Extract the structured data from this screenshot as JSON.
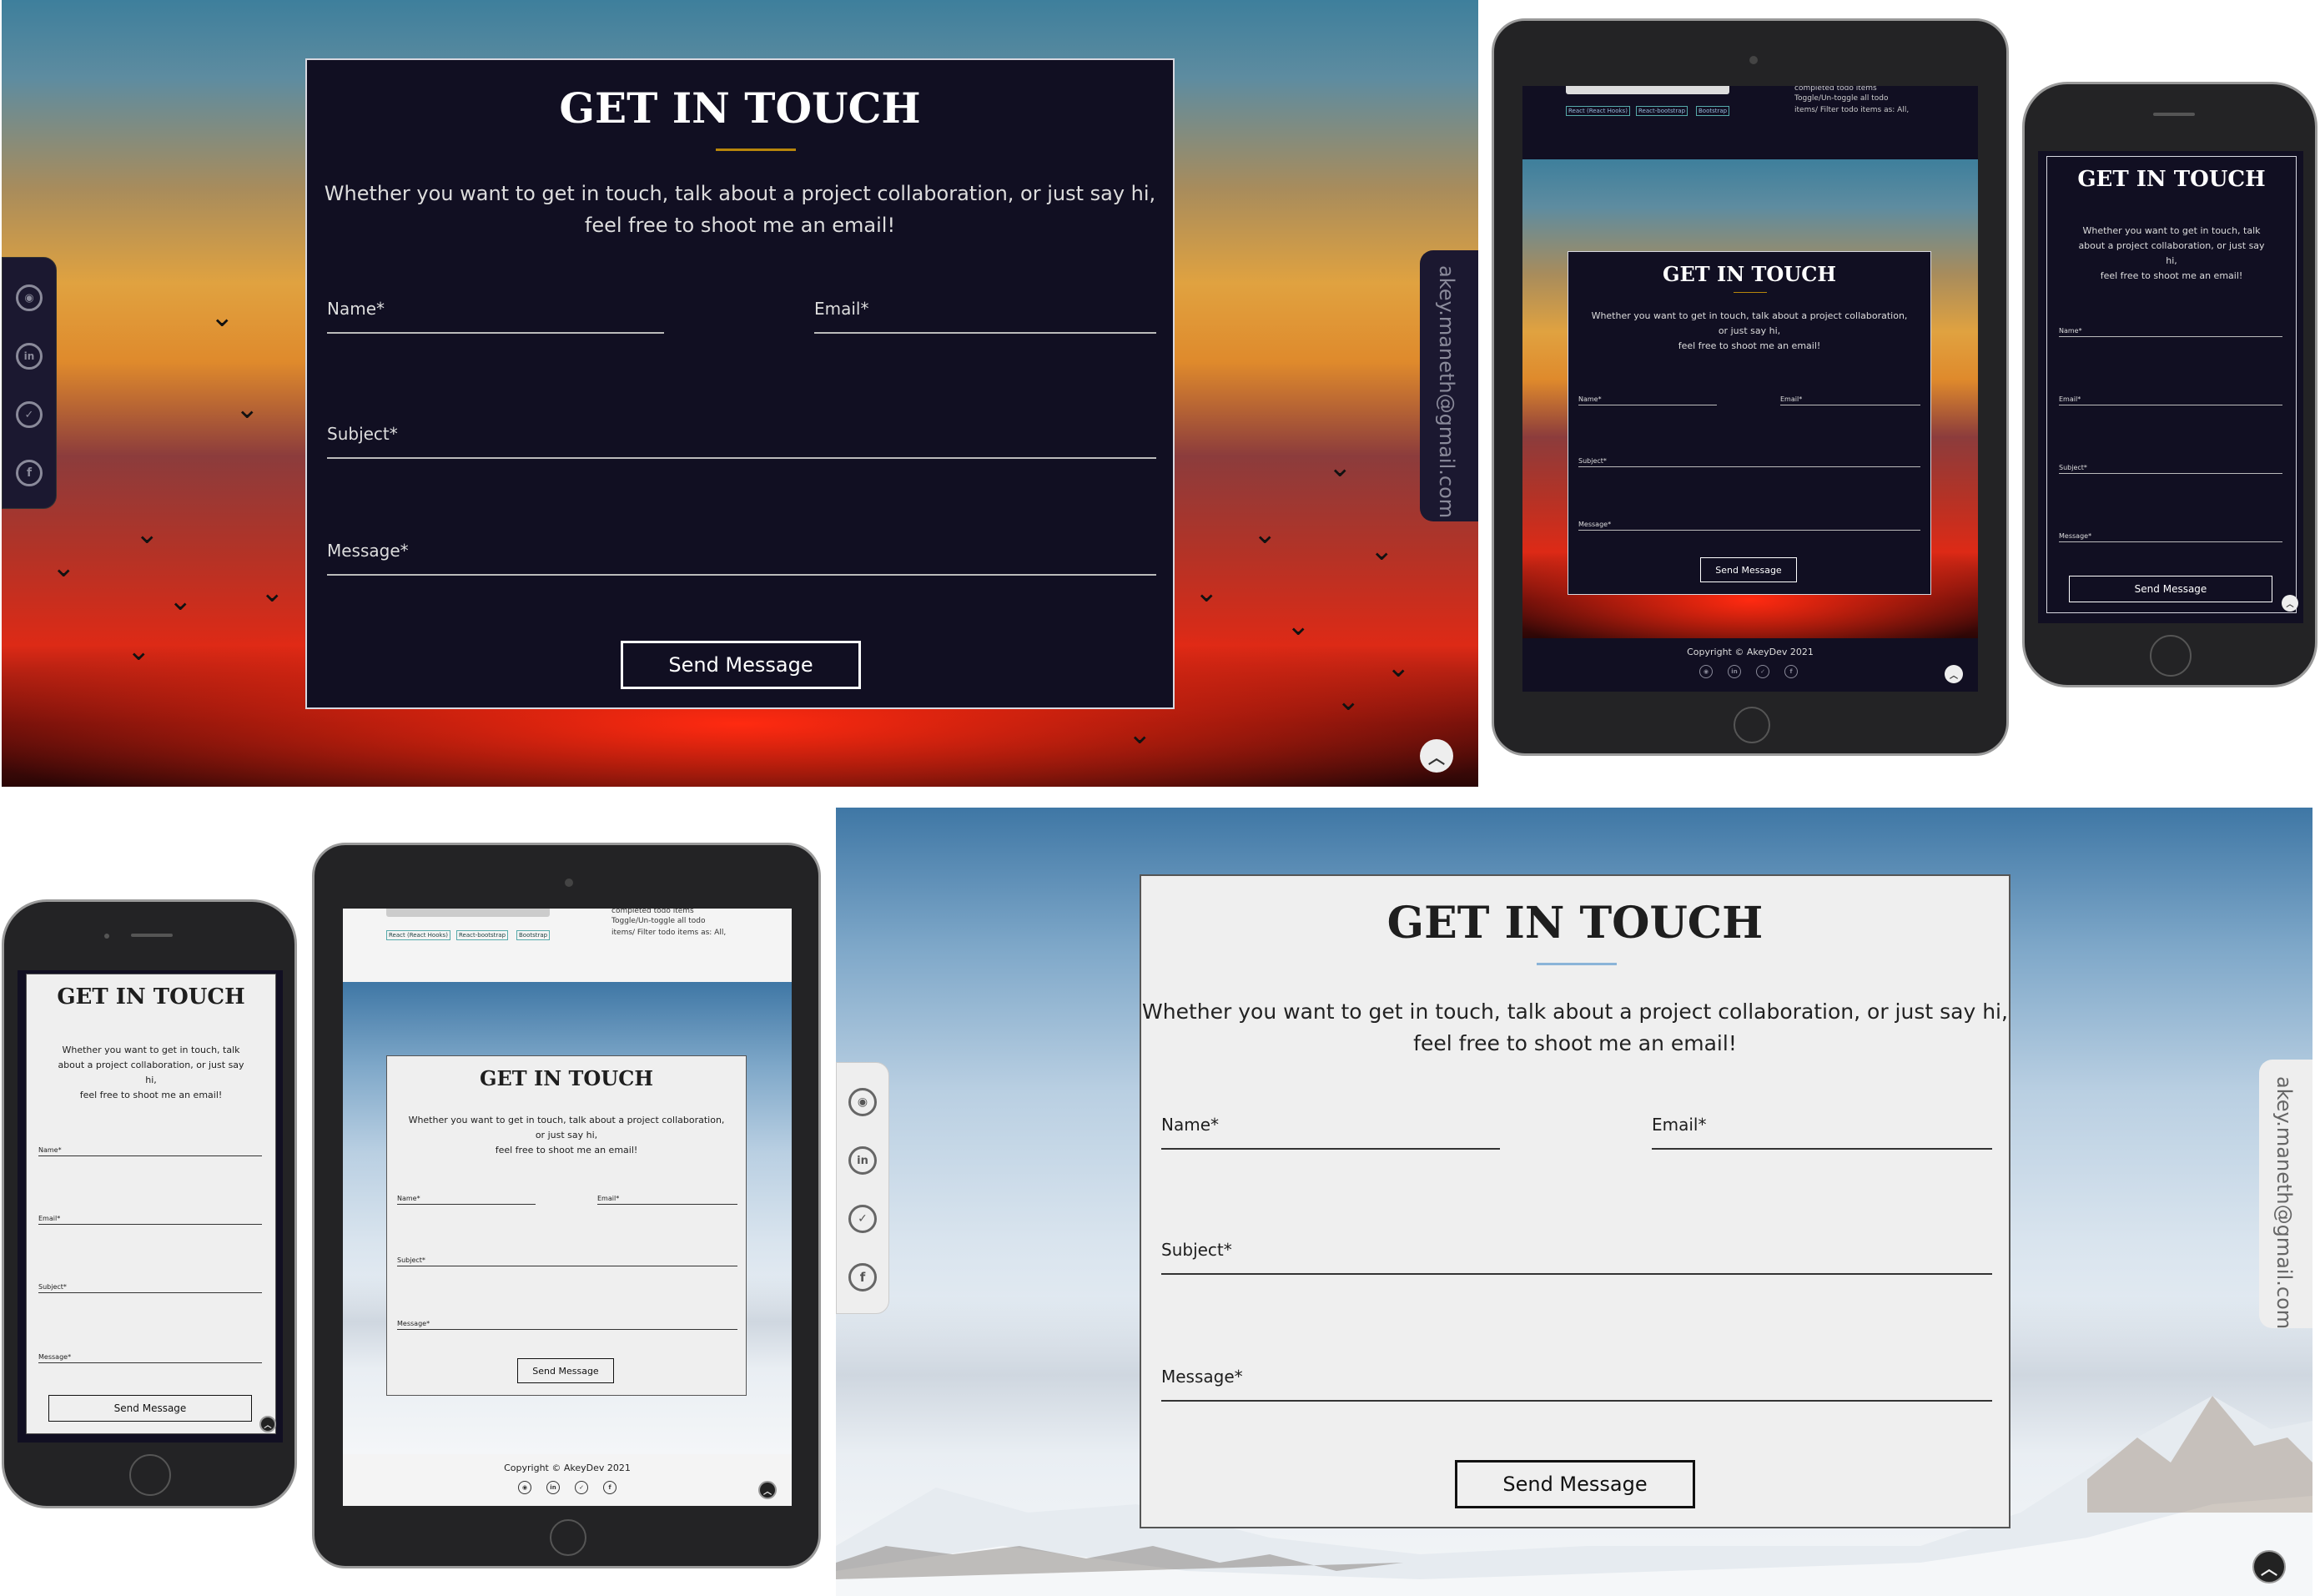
{
  "form": {
    "title": "GET IN TOUCH",
    "intro_line1": "Whether you want to get in touch, talk about a project collaboration, or just say hi,",
    "intro_line2": "feel free to shoot me an email!",
    "intro_small_1": "Whether you want to get in touch, talk about a project collaboration,",
    "intro_small_2": "or just say hi,",
    "phone_line1": "Whether you want to get in touch, talk",
    "phone_line2": "about a project collaboration, or just say",
    "phone_line3": "hi,",
    "name_label": "Name*",
    "email_label": "Email*",
    "subject_label": "Subject*",
    "message_label": "Message*",
    "send_label": "Send Message"
  },
  "email_vertical": "akey.maneth@gmail.com",
  "footer": {
    "copyright": "Copyright © AkeyDev 2021"
  },
  "project_snippet": {
    "desc_line0": "completed todo items",
    "desc_line1": "Toggle/Un-toggle all todo",
    "desc_line2": "items/ Filter todo items as: All,",
    "tag1": "React (React Hooks)",
    "tag2": "React-bootstrap",
    "tag3": "Bootstrap"
  },
  "social_icons": [
    "github-icon",
    "linkedin-icon",
    "twitter-icon",
    "facebook-icon"
  ],
  "colors": {
    "dark_card": "#110f22",
    "light_card": "#efefef",
    "accent_line": "#b8860b",
    "accent_line_light": "#8ab4d8"
  }
}
